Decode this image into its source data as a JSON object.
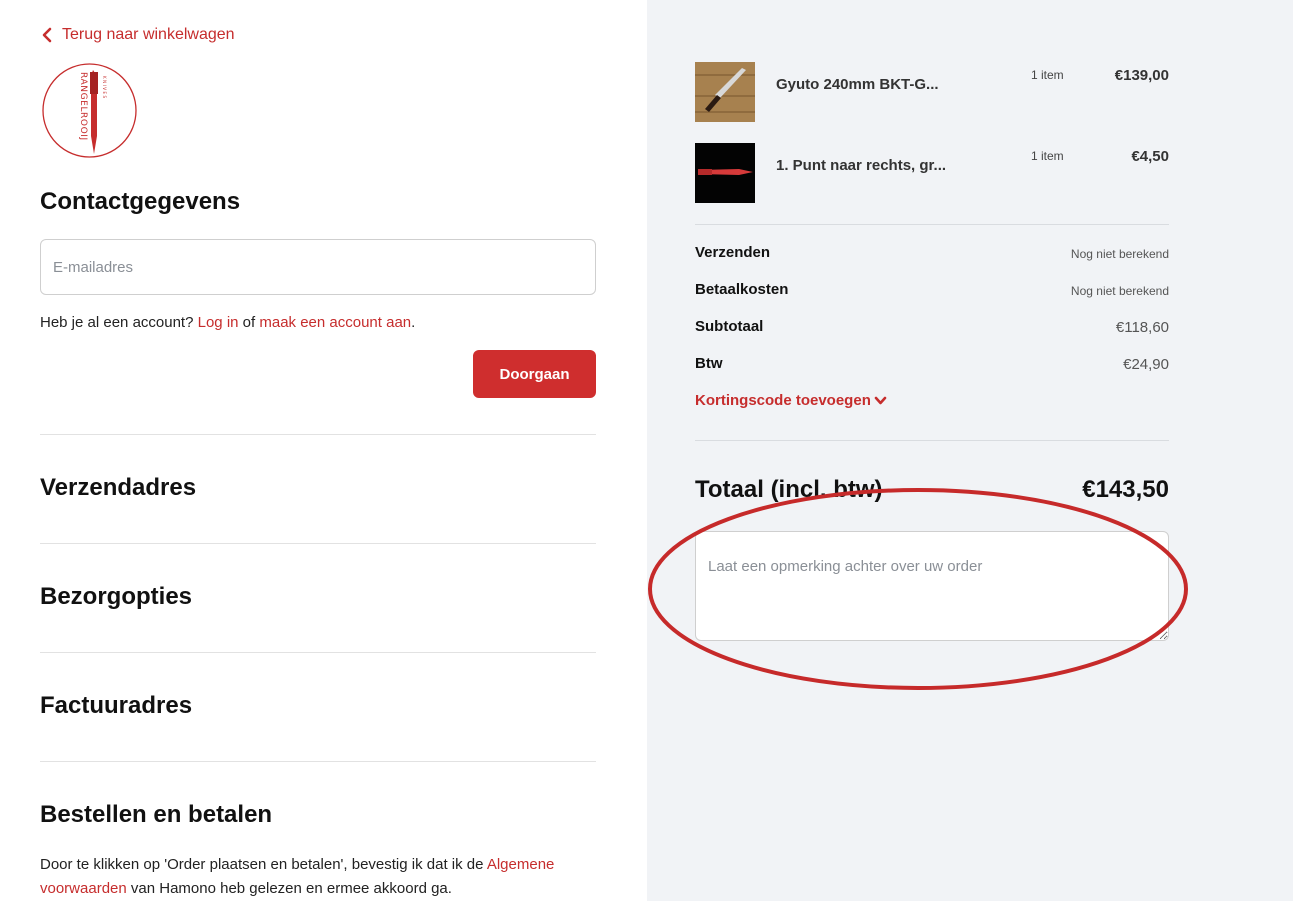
{
  "nav": {
    "back_label": "Terug naar winkelwagen"
  },
  "logo": {
    "text": "RANGELROOIJ",
    "subtext": "KNIVES",
    "color": "#c62d2d"
  },
  "contact": {
    "heading": "Contactgegevens",
    "email_placeholder": "E-mailadres",
    "account_prefix": "Heb je al een account? ",
    "login_label": "Log in",
    "or_text": " of ",
    "create_account_label": "maak een account aan",
    "period": ".",
    "continue_label": "Doorgaan"
  },
  "sections": {
    "shipping_address": "Verzendadres",
    "delivery_options": "Bezorgopties",
    "billing_address": "Factuuradres",
    "order_pay": "Bestellen en betalen"
  },
  "terms": {
    "prefix": "Door te klikken op 'Order plaatsen en betalen', bevestig ik dat ik de ",
    "link": "Algemene voorwaarden",
    "suffix": " van Hamono heb gelezen en ermee akkoord ga."
  },
  "cart": {
    "items": [
      {
        "name": "Gyuto 240mm BKT-G...",
        "qty": "1 item",
        "price": "€139,00",
        "thumb_icon": "knife-on-wood-thumbnail"
      },
      {
        "name": "1. Punt naar rechts, gr...",
        "qty": "1 item",
        "price": "€4,50",
        "thumb_icon": "red-knife-on-black-thumbnail"
      }
    ],
    "summary": [
      {
        "label": "Verzenden",
        "value": "Nog niet berekend"
      },
      {
        "label": "Betaalkosten",
        "value": "Nog niet berekend"
      },
      {
        "label": "Subtotaal",
        "value": "€118,60"
      },
      {
        "label": "Btw",
        "value": "€24,90"
      }
    ],
    "discount_label": "Kortingscode toevoegen",
    "total_label": "Totaal (incl. btw)",
    "total_value": "€143,50",
    "note_placeholder": "Laat een opmerking achter over uw order"
  },
  "colors": {
    "accent": "#c62d2d",
    "button": "#cf2e2e",
    "sidebar_bg": "#f1f3f6",
    "annotation": "#c62a2a"
  }
}
